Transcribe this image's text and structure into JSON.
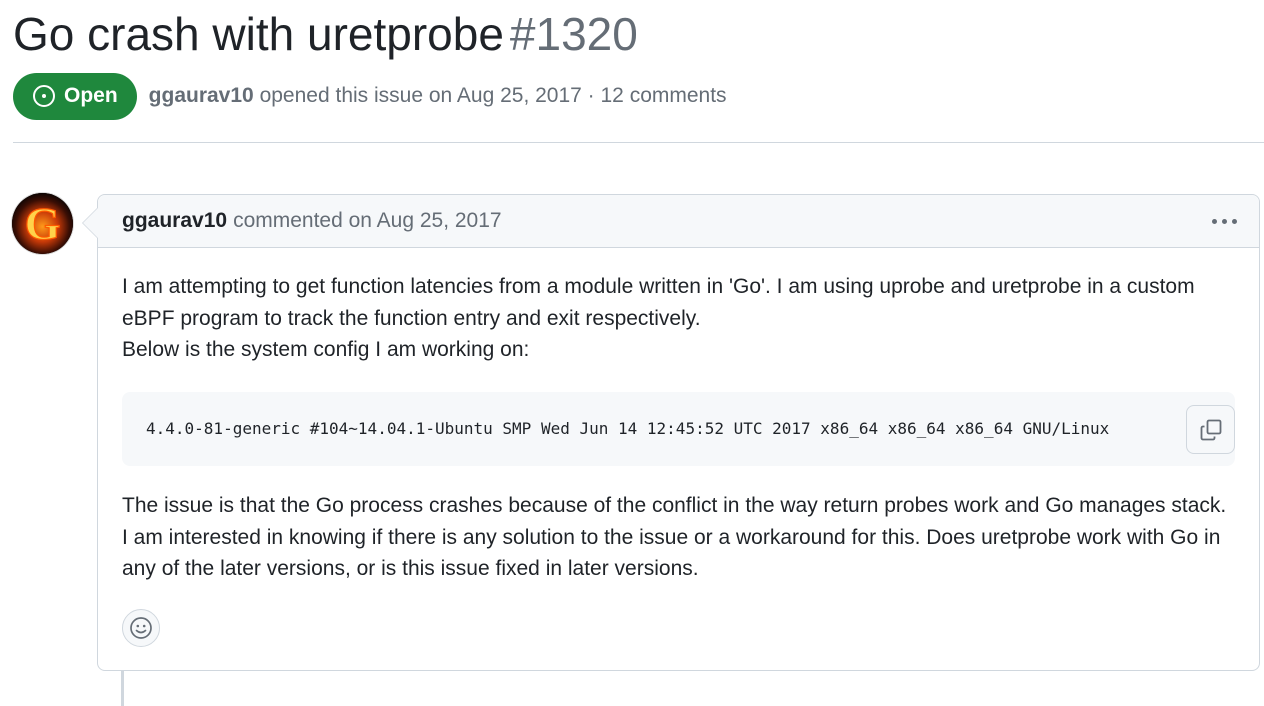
{
  "issue": {
    "title": "Go crash with uretprobe",
    "number": "#1320",
    "state_label": "Open",
    "author": "ggaurav10",
    "meta_suffix": "opened this issue on Aug 25, 2017 · 12 comments",
    "state_color": "#1f883d"
  },
  "comment": {
    "author": "ggaurav10",
    "avatar_letter": "G",
    "action": "commented on Aug 25, 2017",
    "paragraph1": [
      "I am attempting to get function latencies from a module written in 'Go'. I am using uprobe and uretprobe in a custom",
      "eBPF program to track the function entry and exit respectively.",
      "Below is the system config I am working on:"
    ],
    "code": "4.4.0-81-generic #104~14.04.1-Ubuntu SMP Wed Jun 14 12:45:52 UTC 2017 x86_64 x86_64 x86_64 GNU/Linux",
    "paragraph2": [
      "The issue is that the Go process crashes because of the conflict in the way return probes work and Go manages stack.",
      "I am interested in knowing if there is any solution to the issue or a workaround for this. Does uretprobe work with Go in",
      "any of the later versions, or is this issue fixed in later versions."
    ],
    "icons": {
      "menu": "kebab-horizontal-icon",
      "copy": "copy-icon",
      "reaction": "smiley-icon",
      "state": "issue-opened-icon"
    }
  }
}
